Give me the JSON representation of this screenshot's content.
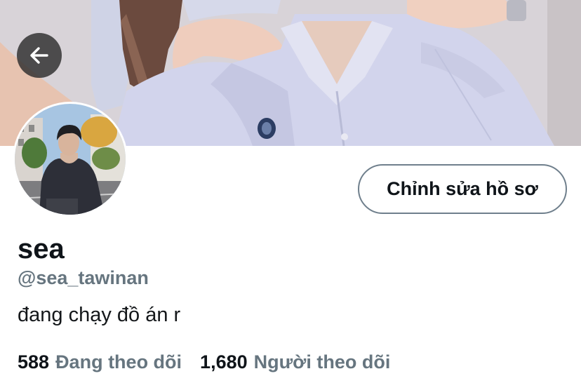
{
  "profile": {
    "display_name": "sea",
    "handle": "@sea_tawinan",
    "bio": "đang chạy đồ án r",
    "edit_button_label": "Chỉnh sửa hồ sơ"
  },
  "stats": {
    "following_count": "588",
    "following_label": "Đang theo dõi",
    "followers_count": "1,680",
    "followers_label": "Người theo dõi"
  },
  "icons": {
    "back": "arrow-left-icon"
  },
  "colors": {
    "primary_text": "#0f1419",
    "secondary_text": "#66757f",
    "button_border": "#6f7f8c",
    "back_button_bg": "#2d2d2d"
  }
}
